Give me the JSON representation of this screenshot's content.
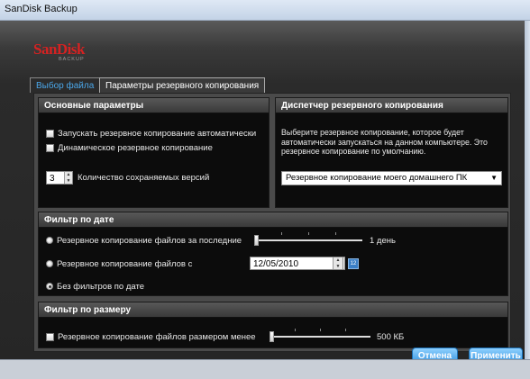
{
  "window": {
    "title": "SanDisk Backup"
  },
  "logo": {
    "brand": "SanDisk",
    "sub": "BACKUP"
  },
  "tabs": [
    {
      "label": "Выбор файла"
    },
    {
      "label": "Параметры резервного копирования"
    }
  ],
  "main_params": {
    "header": "Основные параметры",
    "auto_backup_label": "Запускать резервное копирование автоматически",
    "dynamic_backup_label": "Динамическое резервное копирование",
    "versions_value": "3",
    "versions_label": "Количество сохраняемых версий"
  },
  "manager": {
    "header": "Диспетчер резервного копирования",
    "description": "Выберите резервное копирование, которое будет автоматически запускаться на данном компьютере. Это резервное копирование по умолчанию.",
    "selected": "Резервное копирование моего домашнего ПК"
  },
  "date_filter": {
    "header": "Фильтр по дате",
    "last_label": "Резервное копирование файлов за последние",
    "last_value_label": "1 день",
    "last_slider_level": 0,
    "since_label": "Резервное копирование файлов с",
    "since_date": "12/05/2010",
    "calendar_glyph": "12",
    "none_label": "Без фильтров по дате",
    "selected": "none"
  },
  "size_filter": {
    "header": "Фильтр по размеру",
    "label": "Резервное копирование файлов размером менее",
    "value_label": "500 КБ",
    "slider_level": 0
  },
  "buttons": {
    "cancel": "Отмена",
    "apply": "Применить"
  },
  "colors": {
    "accent": "#2e8fdd",
    "brand": "#d42222",
    "tab_active_text": "#4aa6e8"
  }
}
